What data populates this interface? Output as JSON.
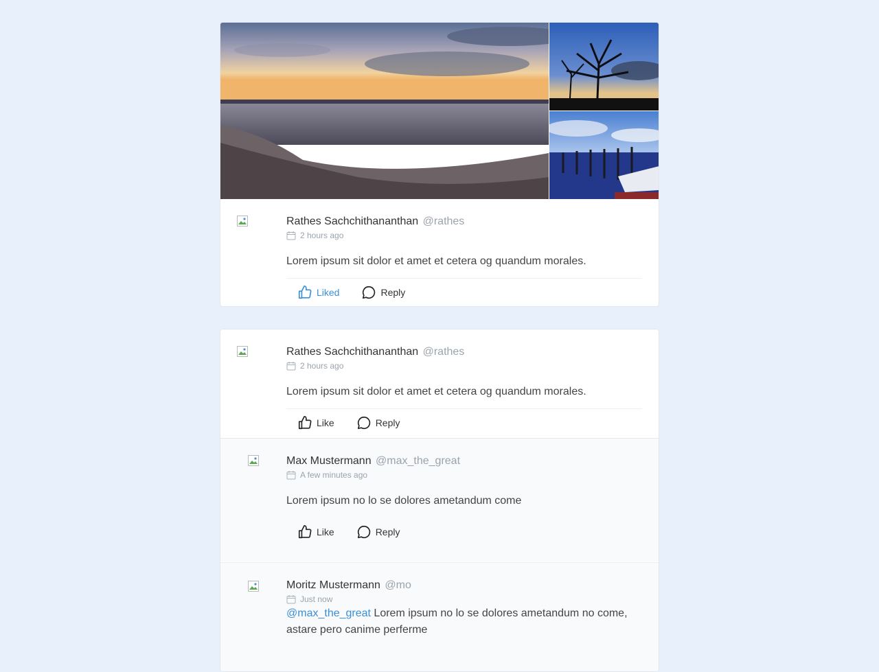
{
  "posts": [
    {
      "author_name": "Rathes Sachchithananthan",
      "author_handle": "@rathes",
      "time": "2 hours ago",
      "text": "Lorem ipsum sit dolor et amet et cetera og quandum morales.",
      "like_label": "Liked",
      "reply_label": "Reply",
      "images": [
        "beach-sunset-photo",
        "bare-trees-photo",
        "marina-boats-photo"
      ]
    },
    {
      "author_name": "Rathes Sachchithananthan",
      "author_handle": "@rathes",
      "time": "2 hours ago",
      "text": "Lorem ipsum sit dolor et amet et cetera og quandum morales.",
      "like_label": "Like",
      "reply_label": "Reply",
      "replies": [
        {
          "author_name": "Max Mustermann",
          "author_handle": "@max_the_great",
          "time": "A few minutes ago",
          "text": "Lorem ipsum no lo se dolores ametandum come",
          "like_label": "Like",
          "reply_label": "Reply"
        },
        {
          "author_name": "Moritz Mustermann",
          "author_handle": "@mo",
          "time": "Just now",
          "mention": "@max_the_great",
          "text": " Lorem ipsum no lo se dolores ametandum no come, astare pero canime perferme"
        }
      ]
    }
  ],
  "colors": {
    "page_bg": "#e8f1fb",
    "accent": "#3a8fd6",
    "muted": "#9aa3ad"
  }
}
